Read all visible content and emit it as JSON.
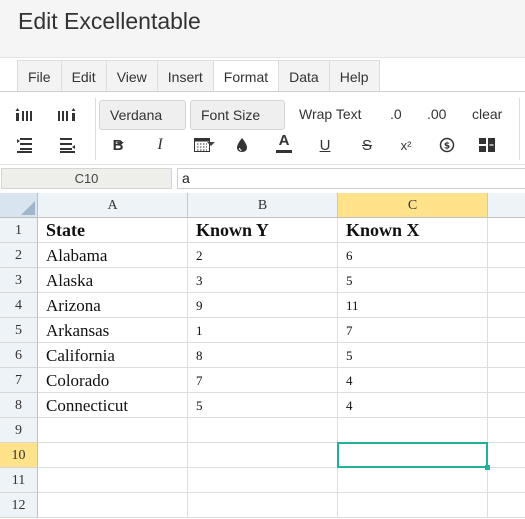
{
  "app": {
    "title": "Edit Excellentable"
  },
  "menu": {
    "tabs": [
      {
        "label": "File",
        "active": false
      },
      {
        "label": "Edit",
        "active": false
      },
      {
        "label": "View",
        "active": false
      },
      {
        "label": "Insert",
        "active": false
      },
      {
        "label": "Format",
        "active": true
      },
      {
        "label": "Data",
        "active": false
      },
      {
        "label": "Help",
        "active": false
      }
    ]
  },
  "toolbar": {
    "font_family": "Verdana",
    "font_size": "Font Size",
    "wrap_text": "Wrap Text",
    "decimal_decrease": ".0",
    "decimal_increase": ".00",
    "clear": "clear",
    "bold": "B",
    "italic": "I",
    "font_color": "A",
    "underline": "U",
    "strike": "S",
    "superscript": "x²"
  },
  "formula_bar": {
    "cell_ref": "C10",
    "value": "a"
  },
  "sheet": {
    "columns": [
      "A",
      "B",
      "C"
    ],
    "selected_column": "C",
    "selected_row": "10",
    "rows": [
      {
        "num": "1",
        "cells": [
          "State",
          "Known Y",
          "Known X"
        ]
      },
      {
        "num": "2",
        "cells": [
          "Alabama",
          "2",
          "6"
        ]
      },
      {
        "num": "3",
        "cells": [
          "Alaska",
          "3",
          "5"
        ]
      },
      {
        "num": "4",
        "cells": [
          "Arizona",
          "9",
          "11"
        ]
      },
      {
        "num": "5",
        "cells": [
          "Arkansas",
          "1",
          "7"
        ]
      },
      {
        "num": "6",
        "cells": [
          "California",
          "8",
          "5"
        ]
      },
      {
        "num": "7",
        "cells": [
          "Colorado",
          "7",
          "4"
        ]
      },
      {
        "num": "8",
        "cells": [
          "Connecticut",
          "5",
          "4"
        ]
      },
      {
        "num": "9",
        "cells": [
          "",
          "",
          ""
        ]
      },
      {
        "num": "10",
        "cells": [
          "",
          "",
          ""
        ]
      },
      {
        "num": "11",
        "cells": [
          "",
          "",
          ""
        ]
      },
      {
        "num": "12",
        "cells": [
          "",
          "",
          ""
        ]
      }
    ]
  },
  "colors": {
    "selection": "#20b09b",
    "header_selected": "#ffe28a",
    "header_bg": "#eef3f7"
  }
}
